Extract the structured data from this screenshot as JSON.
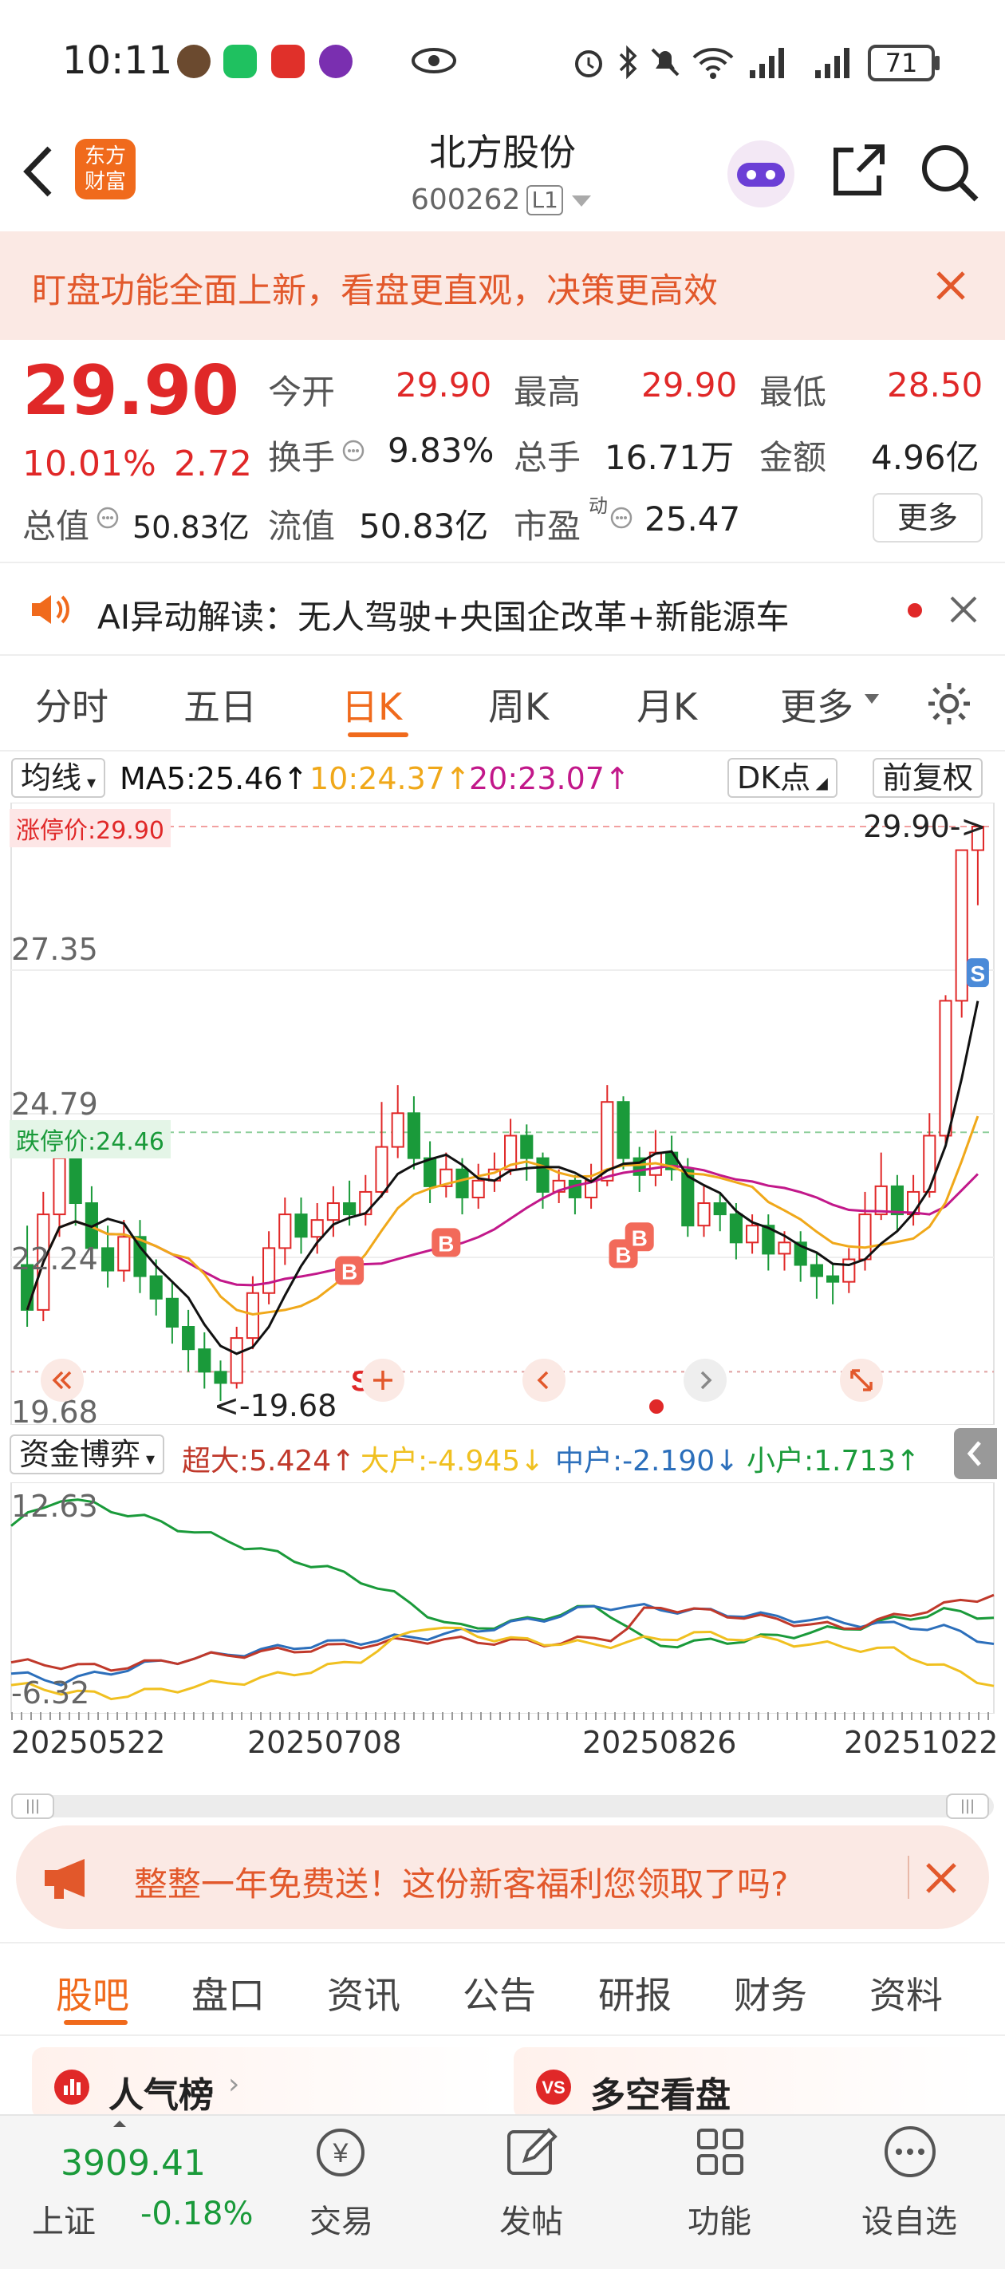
{
  "status": {
    "time": "10:11",
    "battery": "71"
  },
  "nav": {
    "title": "北方股份",
    "code": "600262",
    "level": "L1",
    "logo_line1": "东方",
    "logo_line2": "财富"
  },
  "banner": {
    "text": "盯盘功能全面上新，看盘更直观，决策更高效"
  },
  "quote": {
    "price": "29.90",
    "change_pct": "10.01%",
    "change": "2.72",
    "open_label": "今开",
    "open": "29.90",
    "high_label": "最高",
    "high": "29.90",
    "low_label": "最低",
    "low": "28.50",
    "turnover_label": "换手",
    "turnover": "9.83%",
    "volume_label": "总手",
    "volume": "16.71万",
    "amount_label": "金额",
    "amount": "4.96亿",
    "mktcap_label": "总值",
    "mktcap": "50.83亿",
    "float_label": "流值",
    "float": "50.83亿",
    "pe_label": "市盈",
    "pe_sup": "动",
    "pe": "25.47",
    "more": "更多"
  },
  "ai": {
    "text": "AI异动解读：无人驾驶+央国企改革+新能源车"
  },
  "period_tabs": [
    "分时",
    "五日",
    "日K",
    "周K",
    "月K",
    "更多"
  ],
  "chart_toolbar": {
    "ma_label": "均线",
    "ma5": "MA5:25.46↑",
    "ma10": "10:24.37↑",
    "ma20": "20:23.07↑",
    "dk": "DK点",
    "adjust": "前复权"
  },
  "price_axis": {
    "limit_up": "涨停价:29.90",
    "top": "29.90->",
    "p1": "27.35",
    "p2": "24.79",
    "limit_down": "跌停价:24.46",
    "p3": "22.24",
    "bottom": "19.68",
    "low_mark": "<-19.68"
  },
  "fund_toolbar": {
    "label": "资金博弈",
    "super": "超大:5.424↑",
    "big": "大户:-4.945↓",
    "mid": "中户:-2.190↓",
    "small": "小户:1.713↑"
  },
  "fund_axis": {
    "top": "12.63",
    "bottom": "-6.32"
  },
  "dates": [
    "20250522",
    "20250708",
    "20250826",
    "20251022"
  ],
  "colors": {
    "up": "#e02828",
    "down": "#1a9a3a",
    "ma5": "#111111",
    "ma10": "#f0a81a",
    "ma20": "#c2188a",
    "super": "#c0392b",
    "big": "#f0c020",
    "mid": "#2c6fbb",
    "small": "#1a9a3a"
  },
  "promo": {
    "text": "整整一年免费送！这份新客福利您领取了吗?"
  },
  "bottom_tabs": [
    "股吧",
    "盘口",
    "资讯",
    "公告",
    "研报",
    "财务",
    "资料"
  ],
  "cards": {
    "left": "人气榜",
    "right": "多空看盘"
  },
  "market": {
    "index": "3909.41",
    "name": "上证",
    "change": "-0.18%"
  },
  "bottom_nav": [
    "交易",
    "发帖",
    "功能",
    "设自选"
  ],
  "chart_data": {
    "type": "candlestick",
    "x_range": [
      "20250522",
      "20251022"
    ],
    "y_range": [
      19.68,
      29.9
    ],
    "candles": [
      [
        22.1,
        21.3,
        22.8,
        21.0
      ],
      [
        21.3,
        23.0,
        23.4,
        21.1
      ],
      [
        23.0,
        24.0,
        24.6,
        22.6
      ],
      [
        24.0,
        23.2,
        24.4,
        22.8
      ],
      [
        23.2,
        22.4,
        23.5,
        22.1
      ],
      [
        22.4,
        22.0,
        22.8,
        21.7
      ],
      [
        22.0,
        22.6,
        22.9,
        21.8
      ],
      [
        22.6,
        21.9,
        22.9,
        21.6
      ],
      [
        21.9,
        21.5,
        22.2,
        21.2
      ],
      [
        21.5,
        21.0,
        21.8,
        20.7
      ],
      [
        21.0,
        20.6,
        21.3,
        20.2
      ],
      [
        20.6,
        20.2,
        20.9,
        19.9
      ],
      [
        20.2,
        20.0,
        20.4,
        19.68
      ],
      [
        20.0,
        20.8,
        21.0,
        19.9
      ],
      [
        20.8,
        21.6,
        21.9,
        20.6
      ],
      [
        21.6,
        22.4,
        22.7,
        21.4
      ],
      [
        22.4,
        23.0,
        23.3,
        22.1
      ],
      [
        23.0,
        22.6,
        23.3,
        22.3
      ],
      [
        22.6,
        22.9,
        23.2,
        22.3
      ],
      [
        22.9,
        23.2,
        23.5,
        22.6
      ],
      [
        23.2,
        23.0,
        23.6,
        22.8
      ],
      [
        23.0,
        23.4,
        23.7,
        22.8
      ],
      [
        23.4,
        24.2,
        25.0,
        23.3
      ],
      [
        24.2,
        24.8,
        25.3,
        24.0
      ],
      [
        24.8,
        24.0,
        25.1,
        23.8
      ],
      [
        24.0,
        23.5,
        24.3,
        23.2
      ],
      [
        23.5,
        23.8,
        24.1,
        23.3
      ],
      [
        23.8,
        23.3,
        24.0,
        23.0
      ],
      [
        23.3,
        23.6,
        23.9,
        23.1
      ],
      [
        23.6,
        23.8,
        24.1,
        23.4
      ],
      [
        23.8,
        24.4,
        24.7,
        23.7
      ],
      [
        24.4,
        24.0,
        24.6,
        23.6
      ],
      [
        24.0,
        23.4,
        24.1,
        23.1
      ],
      [
        23.4,
        23.6,
        23.8,
        23.2
      ],
      [
        23.6,
        23.3,
        23.7,
        23.0
      ],
      [
        23.3,
        23.6,
        23.9,
        23.1
      ],
      [
        23.6,
        25.0,
        25.3,
        23.5
      ],
      [
        25.0,
        24.0,
        25.1,
        23.8
      ],
      [
        24.0,
        23.7,
        24.2,
        23.4
      ],
      [
        23.7,
        24.1,
        24.5,
        23.5
      ],
      [
        24.1,
        23.8,
        24.4,
        23.6
      ],
      [
        23.8,
        22.8,
        24.0,
        22.6
      ],
      [
        22.8,
        23.2,
        23.5,
        22.6
      ],
      [
        23.2,
        23.0,
        23.4,
        22.7
      ],
      [
        23.0,
        22.5,
        23.2,
        22.2
      ],
      [
        22.5,
        22.8,
        23.0,
        22.3
      ],
      [
        22.8,
        22.3,
        23.0,
        22.0
      ],
      [
        22.3,
        22.5,
        22.7,
        22.0
      ],
      [
        22.5,
        22.1,
        22.7,
        21.8
      ],
      [
        22.1,
        21.9,
        22.3,
        21.5
      ],
      [
        21.9,
        21.8,
        22.1,
        21.4
      ],
      [
        21.8,
        22.2,
        22.4,
        21.6
      ],
      [
        22.2,
        23.0,
        23.4,
        22.0
      ],
      [
        23.0,
        23.5,
        24.1,
        22.9
      ],
      [
        23.5,
        23.0,
        23.7,
        22.7
      ],
      [
        23.0,
        23.4,
        23.7,
        22.8
      ],
      [
        23.4,
        24.4,
        24.8,
        23.3
      ],
      [
        24.4,
        26.8,
        26.9,
        24.2
      ],
      [
        26.8,
        29.48,
        29.48,
        26.5
      ],
      [
        29.48,
        29.9,
        29.9,
        28.5
      ]
    ],
    "ma5_last": 25.46,
    "ma10_last": 24.37,
    "ma20_last": 23.07
  }
}
